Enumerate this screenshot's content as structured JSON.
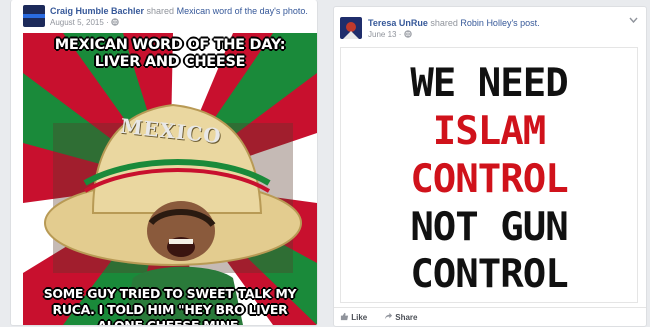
{
  "left_post": {
    "author": "Craig Humble Bachler",
    "action": "shared",
    "shared_item": "Mexican word of the day's photo.",
    "timestamp": "August 5, 2015",
    "privacy_icon": "globe-icon",
    "meme": {
      "top_caption": "MEXICAN WORD OF THE DAY: LIVER AND CHEESE",
      "hat_text": "MEXICO",
      "bottom_caption": "SOME GUY TRIED TO SWEET TALK MY RUCA. I TOLD HIM \"HEY BRO LIVER ALONE CHEESE MINE."
    }
  },
  "right_post": {
    "author": "Teresa UnRue",
    "action": "shared",
    "shared_item": "Robin Holley's post.",
    "timestamp": "June 13",
    "privacy_icon": "globe-icon",
    "image_lines": [
      {
        "text": "WE NEED",
        "color": "#111111"
      },
      {
        "text": "ISLAM",
        "color": "#d0121b"
      },
      {
        "text": "CONTROL",
        "color": "#d0121b"
      },
      {
        "text": "NOT GUN",
        "color": "#111111"
      },
      {
        "text": "CONTROL",
        "color": "#111111"
      }
    ],
    "actions": {
      "like": "Like",
      "share": "Share"
    }
  },
  "colors": {
    "link": "#365899",
    "meta": "#90949c",
    "feed_bg": "#e9ebee",
    "flag_red": "#c8102e",
    "flag_green": "#1a8a3a"
  }
}
